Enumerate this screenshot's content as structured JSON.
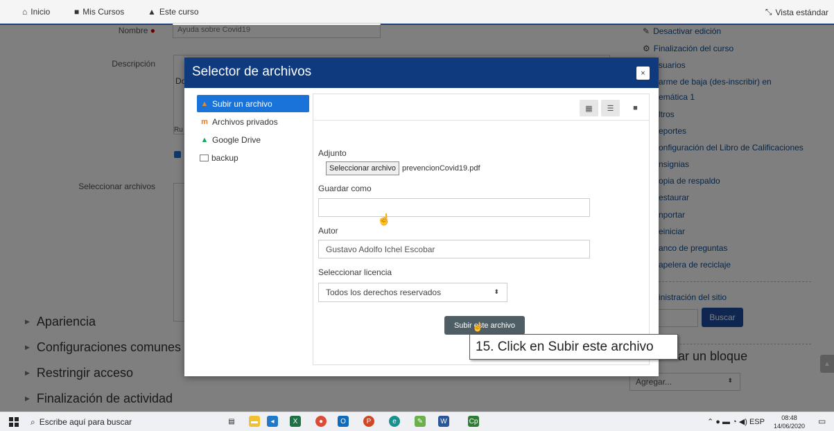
{
  "nav": {
    "home": "Inicio",
    "my_courses": "Mis Cursos",
    "this_course": "Este curso",
    "view_mode": "Vista estándar"
  },
  "form": {
    "name_label": "Nombre",
    "name_value": "Ayuda sobre Covid19",
    "description_label": "Descripción",
    "select_files_label": "Seleccionar archivos",
    "editor_fragments": [
      "Do",
      "Ru"
    ]
  },
  "sections": [
    "Apariencia",
    "Configuraciones comunes",
    "Restringir acceso",
    "Finalización de actividad"
  ],
  "right_sidebar": {
    "items": [
      "Desactivar edición",
      "Finalización del curso",
      "suarios",
      "arme de baja (des-inscribir) en",
      "emática 1",
      "ltros",
      "eportes",
      "onfiguración del Libro de Calificaciones",
      "nsignias",
      "opia de respaldo",
      "estaurar",
      "nportar",
      "einiciar",
      "anco de preguntas",
      "apelera de reciclaje",
      "inistración del sitio"
    ],
    "search_button": "Buscar",
    "add_block_title": "ar un bloque",
    "add_select_value": "Agregar..."
  },
  "modal": {
    "title": "Selector de archivos",
    "close": "×",
    "repositories": [
      {
        "label": "Subir un archivo",
        "icon": "upload-icon"
      },
      {
        "label": "Archivos privados",
        "icon": "private-files-icon"
      },
      {
        "label": "Google Drive",
        "icon": "google-drive-icon"
      },
      {
        "label": "backup",
        "icon": "backup-icon"
      }
    ],
    "attachment_label": "Adjunto",
    "choose_file_button": "Seleccionar archivo",
    "chosen_file": "prevencionCovid19.pdf",
    "save_as_label": "Guardar como",
    "save_as_value": "",
    "author_label": "Autor",
    "author_value": "Gustavo Adolfo Ichel Escobar",
    "license_label": "Seleccionar licencia",
    "license_value": "Todos los derechos reservados",
    "submit_button": "Subir este archivo"
  },
  "tooltip": "15. Click en Subir este archivo",
  "taskbar": {
    "search_placeholder": "Escribe aquí para buscar",
    "language": "ESP",
    "time": "08:48",
    "date": "14/06/2020"
  },
  "colors": {
    "modal_header": "#0f3a7d",
    "active_repo": "#1a73d8",
    "submit_button": "#4f5d65",
    "link": "#0f4b8c"
  }
}
